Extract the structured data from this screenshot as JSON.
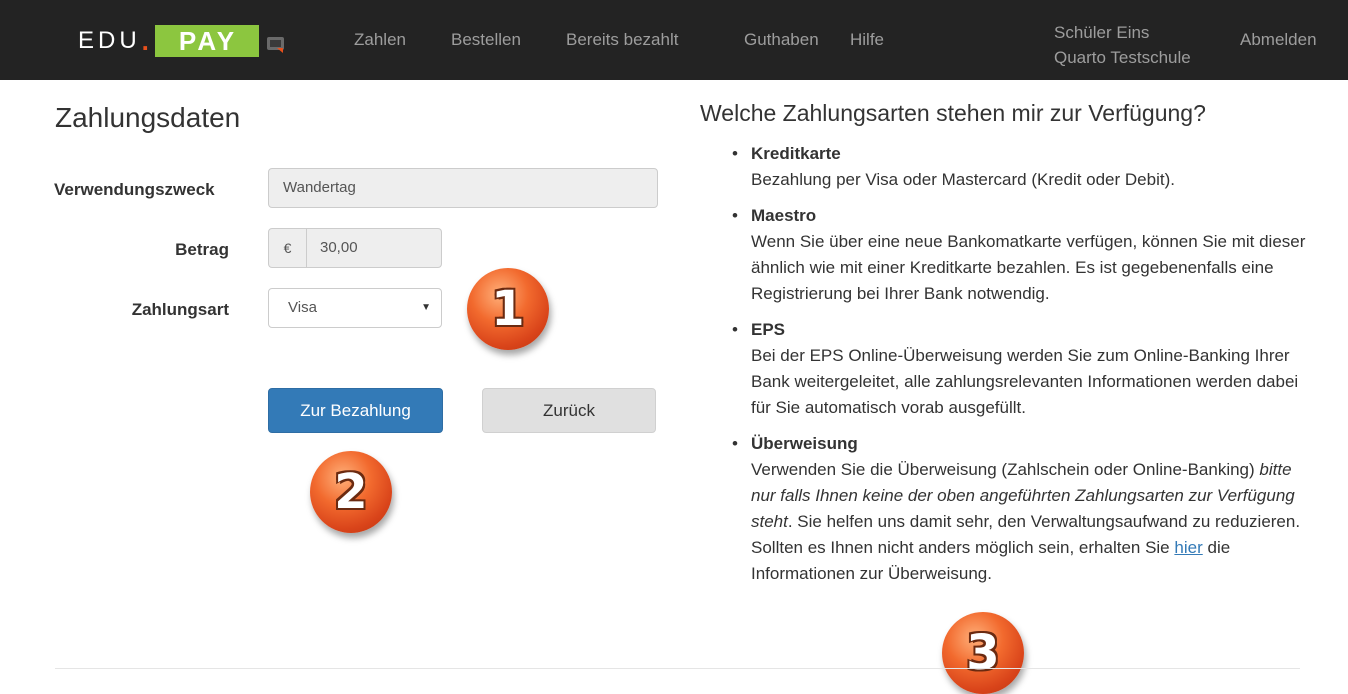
{
  "nav": {
    "logo_edu": "EDU",
    "logo_dot": ".",
    "logo_pay": "PAY",
    "links": [
      "Zahlen",
      "Bestellen",
      "Bereits bezahlt",
      "Guthaben",
      "Hilfe"
    ],
    "user_name": "Schüler Eins",
    "school_name": "Quarto Testschule",
    "logout": "Abmelden"
  },
  "form": {
    "title": "Zahlungsdaten",
    "purpose_label": "Verwendungszweck",
    "purpose_value": "Wandertag",
    "amount_label": "Betrag",
    "currency": "€",
    "amount_value": "30,00",
    "method_label": "Zahlungsart",
    "method_value": "Visa",
    "pay_button": "Zur Bezahlung",
    "back_button": "Zurück"
  },
  "badges": [
    "1",
    "2",
    "3"
  ],
  "info": {
    "title": "Welche Zahlungsarten stehen mir zur Verfügung?",
    "items": [
      {
        "head": "Kreditkarte",
        "text": "Bezahlung per Visa oder Mastercard (Kredit oder Debit)."
      },
      {
        "head": "Maestro",
        "text": "Wenn Sie über eine neue Bankomatkarte verfügen, können Sie mit dieser ähnlich wie mit einer Kreditkarte bezahlen. Es ist gegebenenfalls eine Registrierung bei Ihrer Bank notwendig."
      },
      {
        "head": "EPS",
        "text": "Bei der EPS Online-Überweisung werden Sie zum Online-Banking Ihrer Bank weitergeleitet, alle zahlungsrelevanten Informationen werden dabei für Sie automatisch vorab ausgefüllt."
      },
      {
        "head": "Überweisung",
        "text_a": "Verwenden Sie die Überweisung (Zahlschein oder Online-Banking)",
        "text_em": "bitte nur falls Ihnen keine der oben angeführten Zahlungsarten zur Verfügung steht",
        "text_b": ". Sie helfen uns damit sehr, den Verwaltungsaufwand zu reduzieren. Sollten es Ihnen nicht anders möglich sein, erhalten Sie",
        "link": "hier",
        "text_c": "die Informationen zur Überweisung."
      }
    ]
  }
}
